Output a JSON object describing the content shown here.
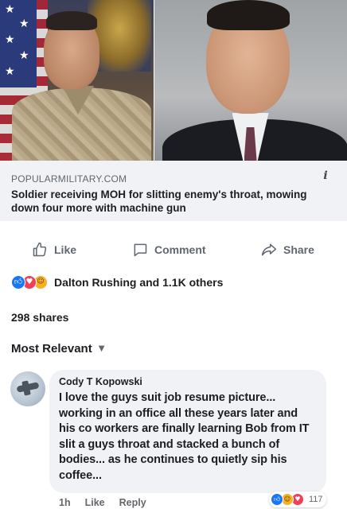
{
  "preview": {
    "source": "POPULARMILITARY.COM",
    "headline": "Soldier receiving MOH for slitting enemy's throat, mowing down four more with machine gun",
    "info_icon": "info-icon"
  },
  "actions": {
    "like": "Like",
    "comment": "Comment",
    "share": "Share"
  },
  "reactions": {
    "icons": [
      "like-reaction-icon",
      "love-reaction-icon",
      "haha-reaction-icon"
    ],
    "summary": "Dalton Rushing and 1.1K others"
  },
  "shares": "298 shares",
  "sort": {
    "label": "Most Relevant"
  },
  "comment": {
    "author": "Cody T Kopowski",
    "text": "I love the guys suit job resume picture... working in an office all these years later and his co workers are finally learning Bob from IT slit a guys throat and stacked a bunch of bodies... as he continues to quietly sip his coffee...",
    "time": "1h",
    "like": "Like",
    "reply": "Reply",
    "reaction_count": "117"
  },
  "colors": {
    "accent": "#1877f2",
    "love": "#f33e58",
    "haha": "#f7b125",
    "muted": "#606770",
    "caption_bg": "#f0f2f5"
  }
}
